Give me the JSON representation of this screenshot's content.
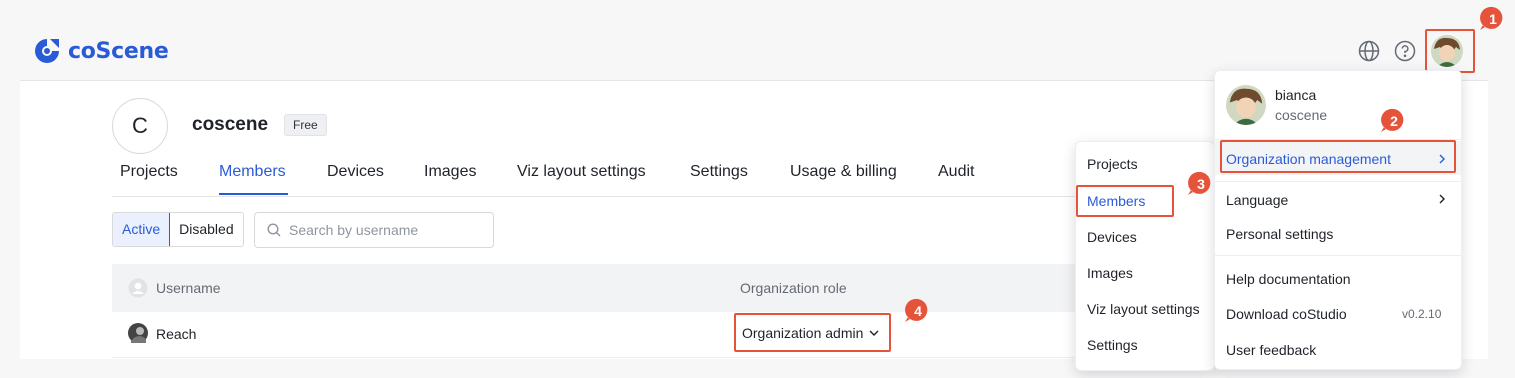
{
  "header": {
    "logo_text": "coScene",
    "globe_icon": "globe-icon",
    "help_icon": "help-icon",
    "avatar_icon": "user-avatar"
  },
  "org": {
    "avatar_letter": "C",
    "name": "coscene",
    "plan": "Free"
  },
  "tabs": [
    {
      "label": "Projects"
    },
    {
      "label": "Members",
      "active": true
    },
    {
      "label": "Devices"
    },
    {
      "label": "Images"
    },
    {
      "label": "Viz layout settings"
    },
    {
      "label": "Settings"
    },
    {
      "label": "Usage & billing"
    },
    {
      "label": "Audit"
    }
  ],
  "filters": {
    "active_label": "Active",
    "disabled_label": "Disabled",
    "search_placeholder": "Search by username"
  },
  "table": {
    "col_username": "Username",
    "col_role": "Organization role",
    "rows": [
      {
        "username": "Reach",
        "role": "Organization admin"
      }
    ]
  },
  "user_menu": {
    "username": "bianca",
    "org": "coscene",
    "org_management": "Organization management",
    "language": "Language",
    "personal_settings": "Personal settings",
    "help_docs": "Help documentation",
    "download": "Download coStudio",
    "download_version": "v0.2.10",
    "feedback": "User feedback"
  },
  "org_submenu": [
    {
      "label": "Projects"
    },
    {
      "label": "Members"
    },
    {
      "label": "Devices"
    },
    {
      "label": "Images"
    },
    {
      "label": "Viz layout settings"
    },
    {
      "label": "Settings"
    }
  ],
  "annotations": [
    "1",
    "2",
    "3",
    "4"
  ],
  "colors": {
    "brand": "#2a5bd7",
    "highlight": "#e5543a"
  }
}
